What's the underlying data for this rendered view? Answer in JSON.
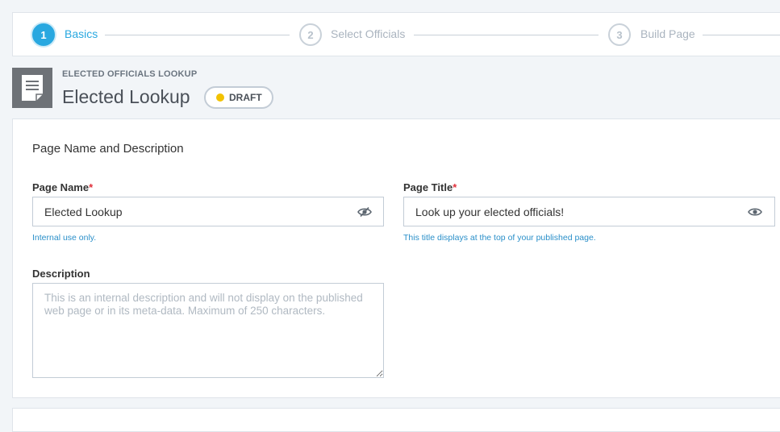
{
  "stepper": {
    "steps": [
      {
        "number": "1",
        "label": "Basics",
        "state": "active"
      },
      {
        "number": "2",
        "label": "Select Officials",
        "state": "inactive"
      },
      {
        "number": "3",
        "label": "Build Page",
        "state": "inactive"
      }
    ]
  },
  "header": {
    "icon": "document-icon",
    "subtitle": "ELECTED OFFICIALS LOOKUP",
    "title": "Elected Lookup",
    "status_badge": "DRAFT",
    "status_color": "#f2c200"
  },
  "form": {
    "section_title": "Page Name and Description",
    "page_name": {
      "label": "Page Name",
      "required_marker": "*",
      "value": "Elected Lookup",
      "help": "Internal use only.",
      "icon": "eye-slash-icon"
    },
    "page_title": {
      "label": "Page Title",
      "required_marker": "*",
      "value": "Look up your elected officials!",
      "help": "This title displays at the top of your published page.",
      "icon": "eye-icon"
    },
    "description": {
      "label": "Description",
      "value": "",
      "placeholder": "This is an internal description and will not display on the published web page or in its meta-data. Maximum of 250 characters."
    }
  },
  "colors": {
    "accent": "#29a8e0",
    "help_text": "#2a8fc9",
    "required": "#e0303a"
  }
}
